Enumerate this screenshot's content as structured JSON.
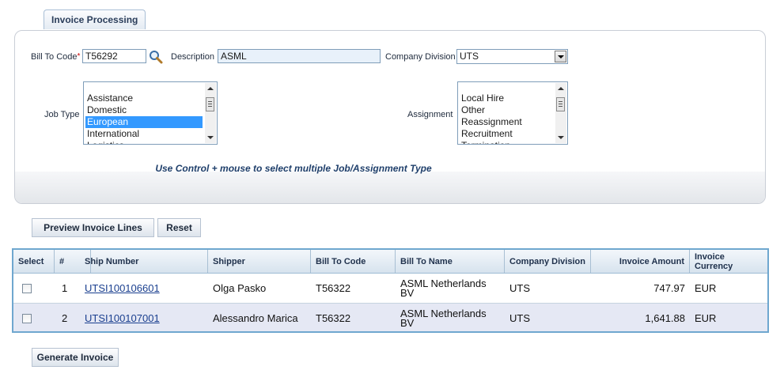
{
  "tab": {
    "label": "Invoice Processing"
  },
  "form": {
    "bill_to_code_label": "Bill To Code",
    "required_marker": "*",
    "bill_to_code_value": "T56292",
    "description_label": "Description",
    "description_value": "ASML",
    "company_division_label": "Company Division",
    "company_division_value": "UTS",
    "job_type_label": "Job Type",
    "job_type_options": [
      {
        "label": "Assistance",
        "selected": false
      },
      {
        "label": "Domestic",
        "selected": false
      },
      {
        "label": "European",
        "selected": true
      },
      {
        "label": "International",
        "selected": false
      },
      {
        "label": "Logistics",
        "selected": false
      }
    ],
    "assignment_label": "Assignment",
    "assignment_options": [
      {
        "label": "Local Hire",
        "selected": false
      },
      {
        "label": "Other",
        "selected": false
      },
      {
        "label": "Reassignment",
        "selected": false
      },
      {
        "label": "Recruitment",
        "selected": false
      },
      {
        "label": "Termination",
        "selected": false
      }
    ],
    "hint": "Use Control + mouse to select multiple Job/Assignment Type"
  },
  "actions": {
    "preview_label": "Preview Invoice Lines",
    "reset_label": "Reset",
    "generate_label": "Generate Invoice"
  },
  "grid": {
    "columns": [
      "Select",
      "#",
      "Ship Number",
      "Shipper",
      "Bill To Code",
      "Bill To Name",
      "Company Division",
      "Invoice Amount",
      "Invoice Currency"
    ],
    "rows": [
      {
        "num": "1",
        "ship_number": "UTSI100106601",
        "shipper": "Olga Pasko",
        "bill_to_code": "T56322",
        "bill_to_name": "ASML Netherlands BV",
        "company_division": "UTS",
        "invoice_amount": "747.97",
        "invoice_currency": "EUR"
      },
      {
        "num": "2",
        "ship_number": "UTSI100107001",
        "shipper": "Alessandro Marica",
        "bill_to_code": "T56322",
        "bill_to_name": "ASML Netherlands BV",
        "company_division": "UTS",
        "invoice_amount": "1,641.88",
        "invoice_currency": "EUR"
      }
    ]
  },
  "colors": {
    "grid_border": "#6fa7cf",
    "selected_option": "#3399ff",
    "link": "#1a3f8f",
    "required": "#cc0000"
  }
}
